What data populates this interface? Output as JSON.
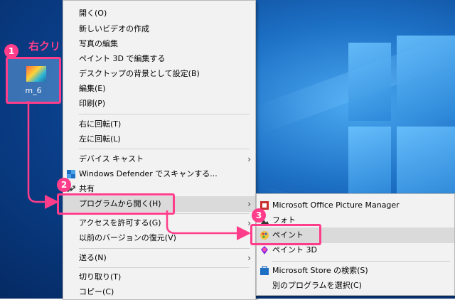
{
  "desktop": {
    "file_name": "m_6"
  },
  "annotations": {
    "step1": "1",
    "step2": "2",
    "step3": "3",
    "right_click": "右クリック"
  },
  "context_menu": {
    "items": [
      {
        "label": "開く(O)"
      },
      {
        "label": "新しいビデオの作成"
      },
      {
        "label": "写真の編集"
      },
      {
        "label": "ペイント 3D で編集する"
      },
      {
        "label": "デスクトップの背景として設定(B)"
      },
      {
        "label": "編集(E)"
      },
      {
        "label": "印刷(P)"
      },
      {
        "label": "右に回転(T)"
      },
      {
        "label": "左に回転(L)"
      },
      {
        "label": "デバイス キャスト"
      },
      {
        "label": "Windows Defender でスキャンする..."
      },
      {
        "label": "共有"
      },
      {
        "label": "プログラムから開く(H)"
      },
      {
        "label": "アクセスを許可する(G)"
      },
      {
        "label": "以前のバージョンの復元(V)"
      },
      {
        "label": "送る(N)"
      },
      {
        "label": "切り取り(T)"
      },
      {
        "label": "コピー(C)"
      }
    ]
  },
  "submenu": {
    "items": [
      {
        "label": "Microsoft Office Picture Manager"
      },
      {
        "label": "フォト"
      },
      {
        "label": "ペイント"
      },
      {
        "label": "ペイント 3D"
      },
      {
        "label": "Microsoft Store の検索(S)"
      },
      {
        "label": "別のプログラムを選択(C)"
      }
    ]
  },
  "colors": {
    "accent": "#ff3d8a",
    "menu_bg": "#f2f2f2",
    "highlight_bg": "#dadada"
  }
}
